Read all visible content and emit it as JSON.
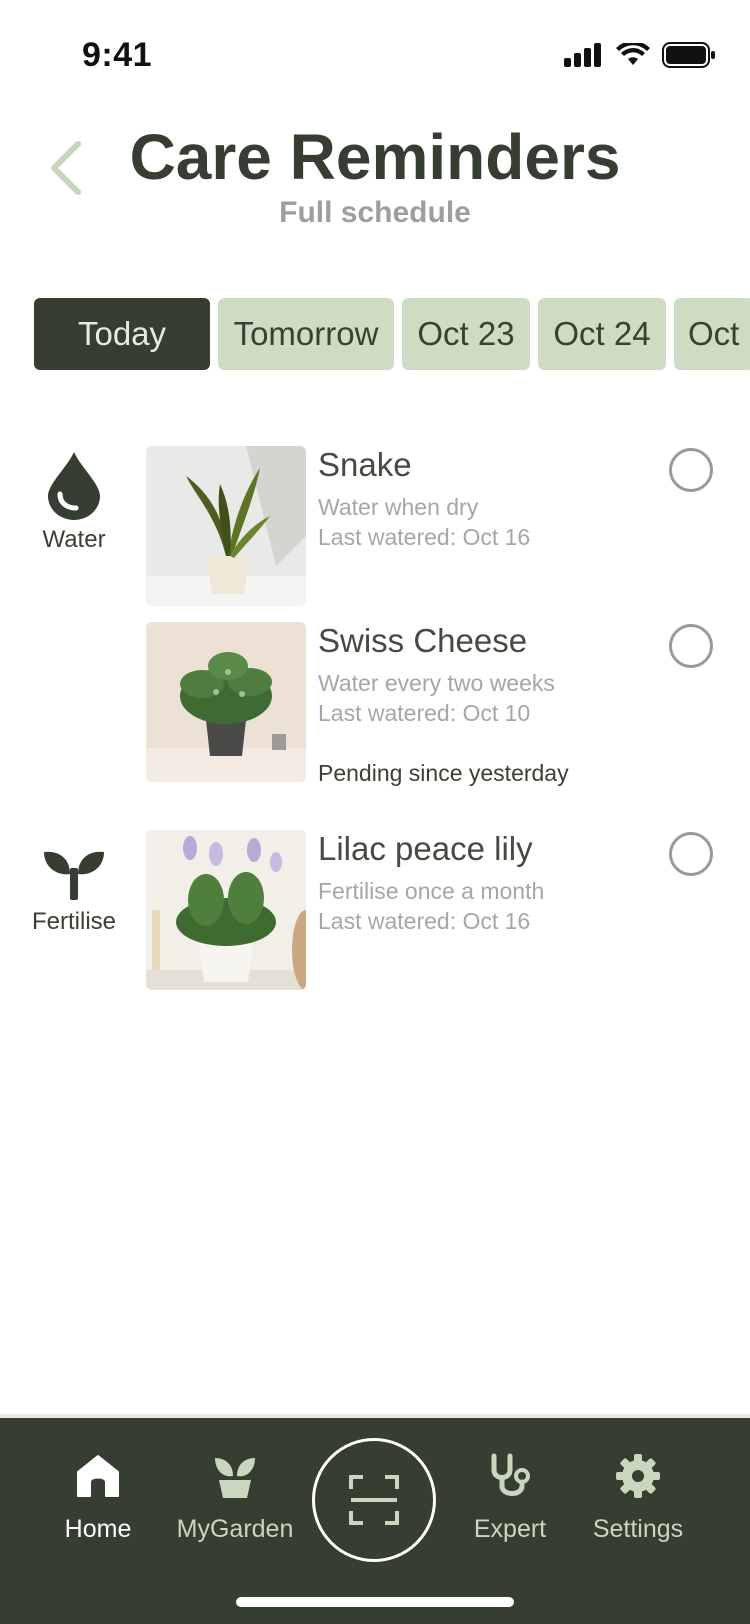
{
  "status": {
    "time": "9:41"
  },
  "header": {
    "title": "Care Reminders",
    "subtitle": "Full schedule"
  },
  "tabs": [
    {
      "label": "Today",
      "active": true
    },
    {
      "label": "Tomorrow",
      "active": false
    },
    {
      "label": "Oct 23",
      "active": false
    },
    {
      "label": "Oct 24",
      "active": false
    },
    {
      "label": "Oct",
      "active": false
    }
  ],
  "categories": {
    "water": {
      "label": "Water",
      "icon": "water-drop-icon"
    },
    "fertilise": {
      "label": "Fertilise",
      "icon": "sprout-icon"
    }
  },
  "plants": [
    {
      "name": "Snake",
      "instruction": "Water when dry",
      "last": "Last watered: Oct 16",
      "pending": ""
    },
    {
      "name": "Swiss Cheese",
      "instruction": "Water every two weeks",
      "last": "Last watered: Oct 10",
      "pending": "Pending since yesterday"
    },
    {
      "name": "Lilac peace lily",
      "instruction": "Fertilise once a month",
      "last": "Last watered: Oct 16",
      "pending": ""
    }
  ],
  "nav": {
    "home": "Home",
    "mygarden": "MyGarden",
    "expert": "Expert",
    "settings": "Settings"
  },
  "colors": {
    "dark_green": "#363d31",
    "light_green": "#cfdcc4",
    "muted_text": "#a6a6a6"
  }
}
